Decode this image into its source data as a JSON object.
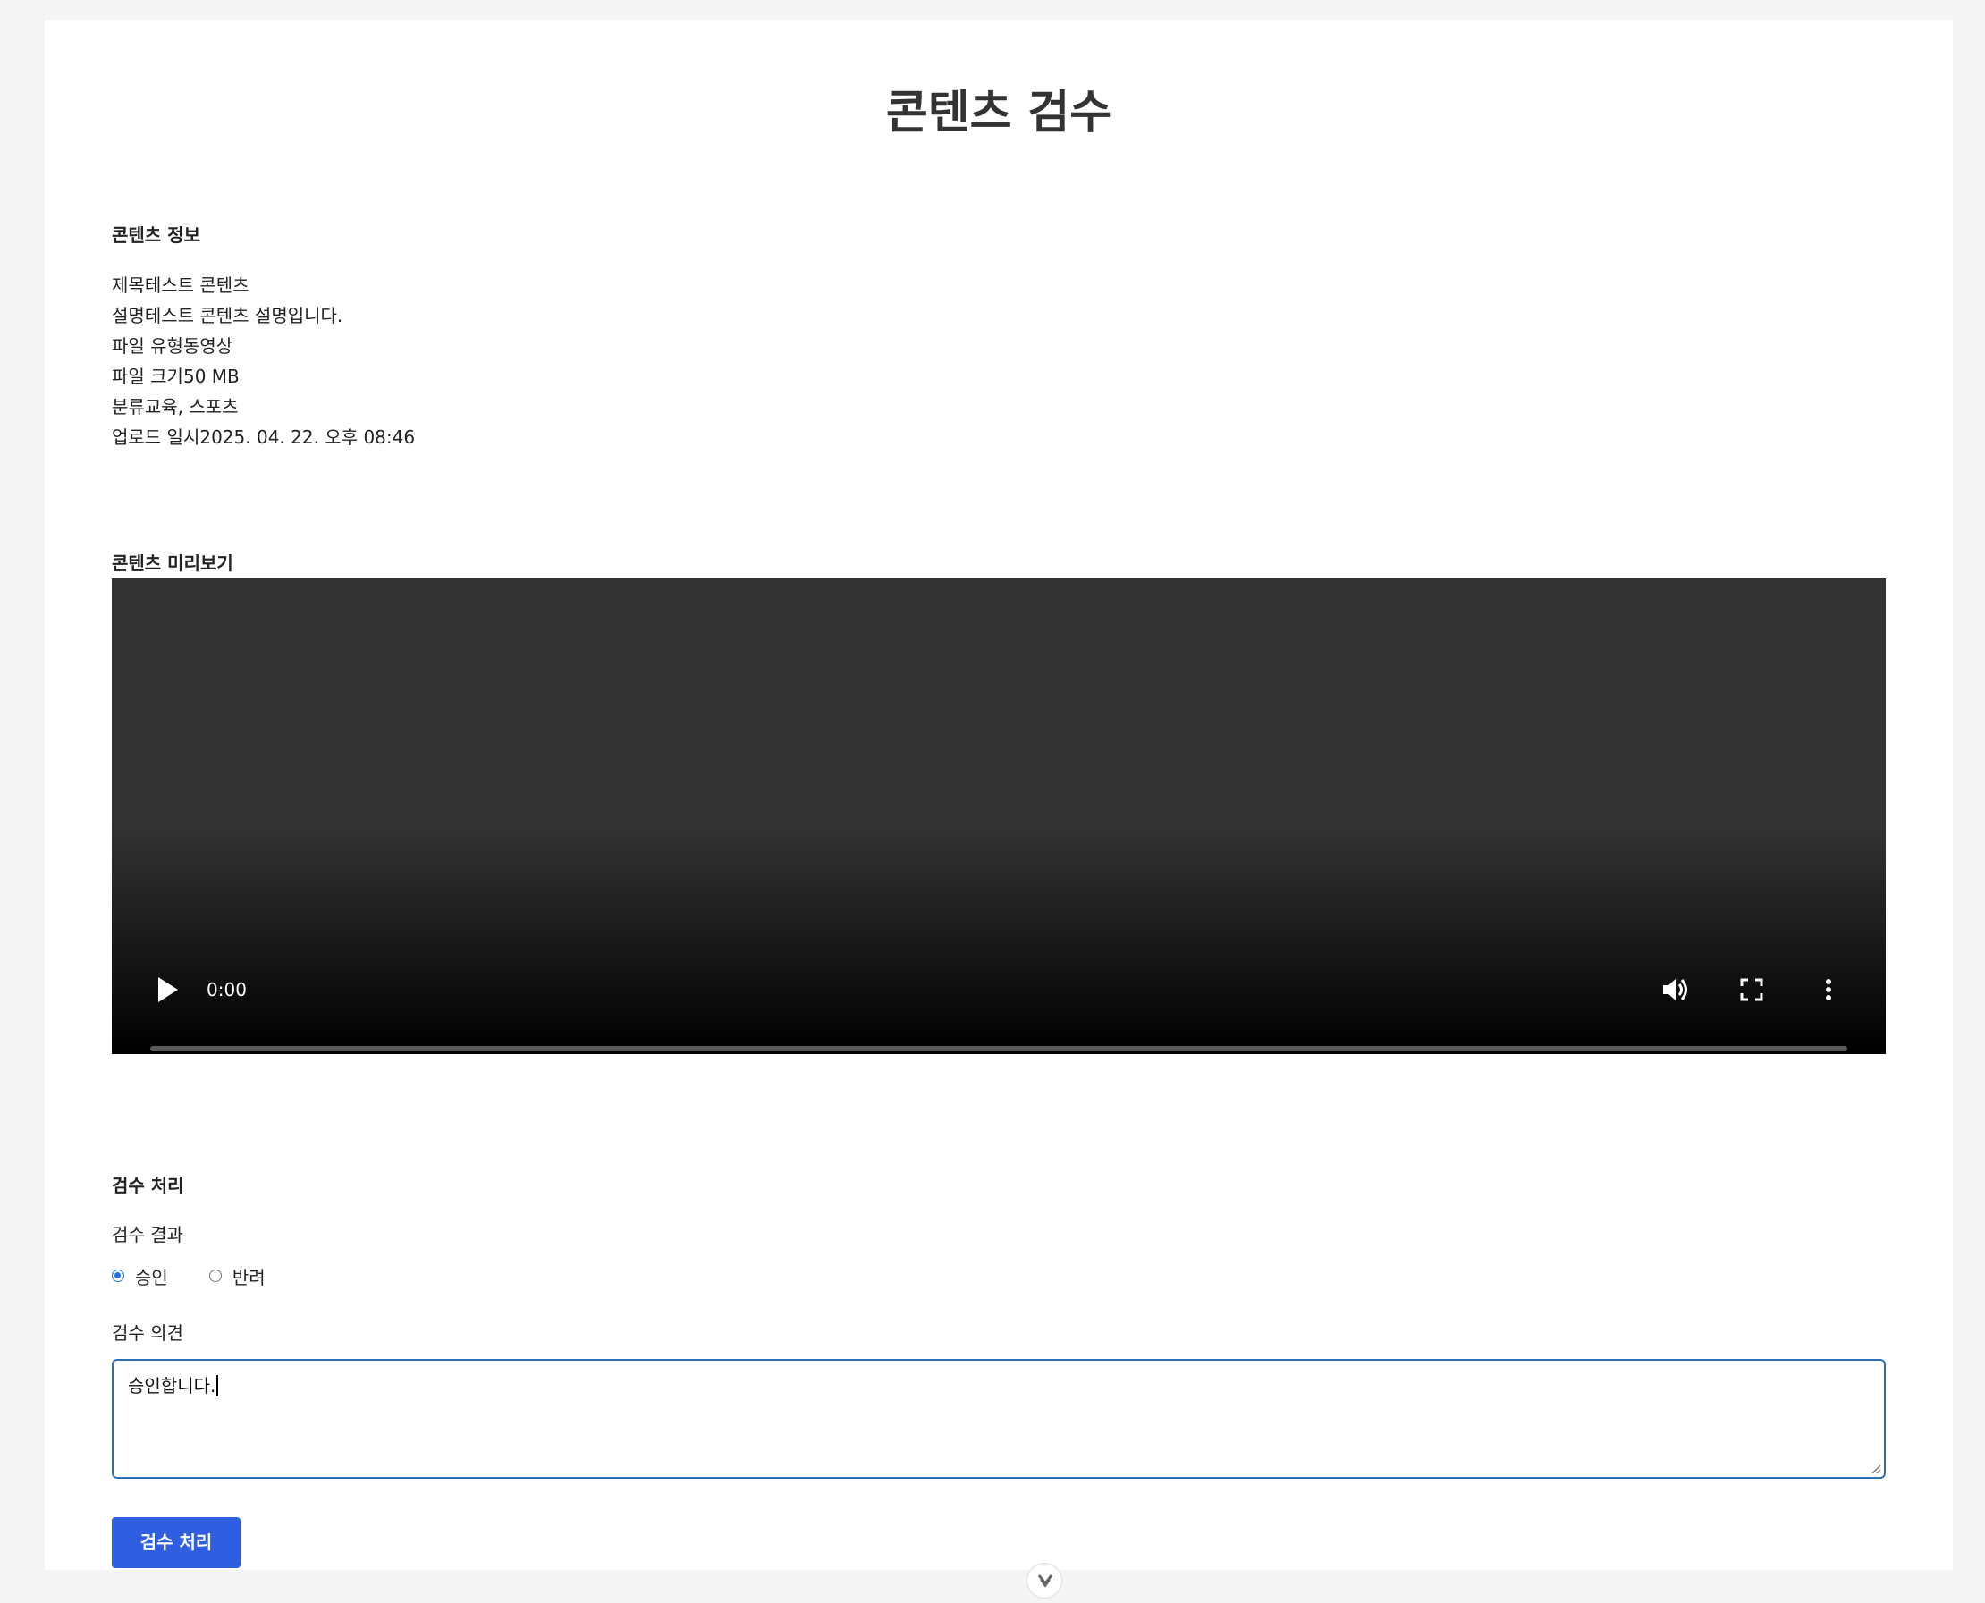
{
  "page": {
    "title": "콘텐츠 검수"
  },
  "content_info": {
    "heading": "콘텐츠 정보",
    "rows": [
      {
        "label": "제목",
        "value": "테스트 콘텐츠"
      },
      {
        "label": "설명",
        "value": "테스트 콘텐츠 설명입니다."
      },
      {
        "label": "파일 유형",
        "value": "동영상"
      },
      {
        "label": "파일 크기",
        "value": "50 MB"
      },
      {
        "label": "분류",
        "value": "교육, 스포츠"
      },
      {
        "label": "업로드 일시",
        "value": "2025. 04. 22. 오후 08:46"
      }
    ]
  },
  "preview": {
    "heading": "콘텐츠 미리보기",
    "video": {
      "current_time": "0:00",
      "progress": 0,
      "icons": [
        "play-icon",
        "volume-icon",
        "fullscreen-icon",
        "more-options-icon"
      ]
    }
  },
  "review": {
    "heading": "검수 처리",
    "result_label": "검수 결과",
    "options": [
      {
        "label": "승인",
        "selected": true
      },
      {
        "label": "반려",
        "selected": false
      }
    ],
    "comment_label": "검수 의견",
    "comment_value": "승인합니다.",
    "submit_label": "검수 처리"
  },
  "scroll_button": {
    "icon": "chevron-down-icon"
  },
  "colors": {
    "page_background": "#f5f5f5",
    "card_background": "#ffffff",
    "primary_button": "#2f5fe0",
    "radio_accent": "#1a73e8",
    "textarea_focus_border": "#2f6db5",
    "video_background": "#333333"
  }
}
